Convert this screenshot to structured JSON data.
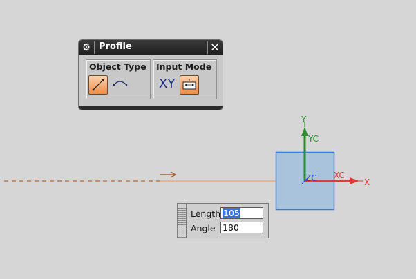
{
  "profile_dialog": {
    "title": "Profile",
    "gear_icon": "gear-icon",
    "close_icon": "close-icon",
    "object_type": {
      "label": "Object Type",
      "options": [
        "line-icon",
        "arc-icon"
      ],
      "selected": "line-icon"
    },
    "input_mode": {
      "label": "Input Mode",
      "xy_label": "XY",
      "selected": "parameter-mode-icon"
    }
  },
  "csys": {
    "y_label": "Y",
    "yc_label": "YC",
    "zc_label": "ZC",
    "xc_label": "XC",
    "x_label": "X"
  },
  "dynamic_input": {
    "length_label": "Length",
    "length_value": "105",
    "angle_label": "Angle",
    "angle_value": "180"
  },
  "colors": {
    "background": "#d6d6d6",
    "accent_orange": "#f08c46",
    "y_axis": "#2e8b2e",
    "x_axis": "#e03a3a",
    "z_axis": "#2244cc",
    "plane": "#a9c3dc"
  }
}
